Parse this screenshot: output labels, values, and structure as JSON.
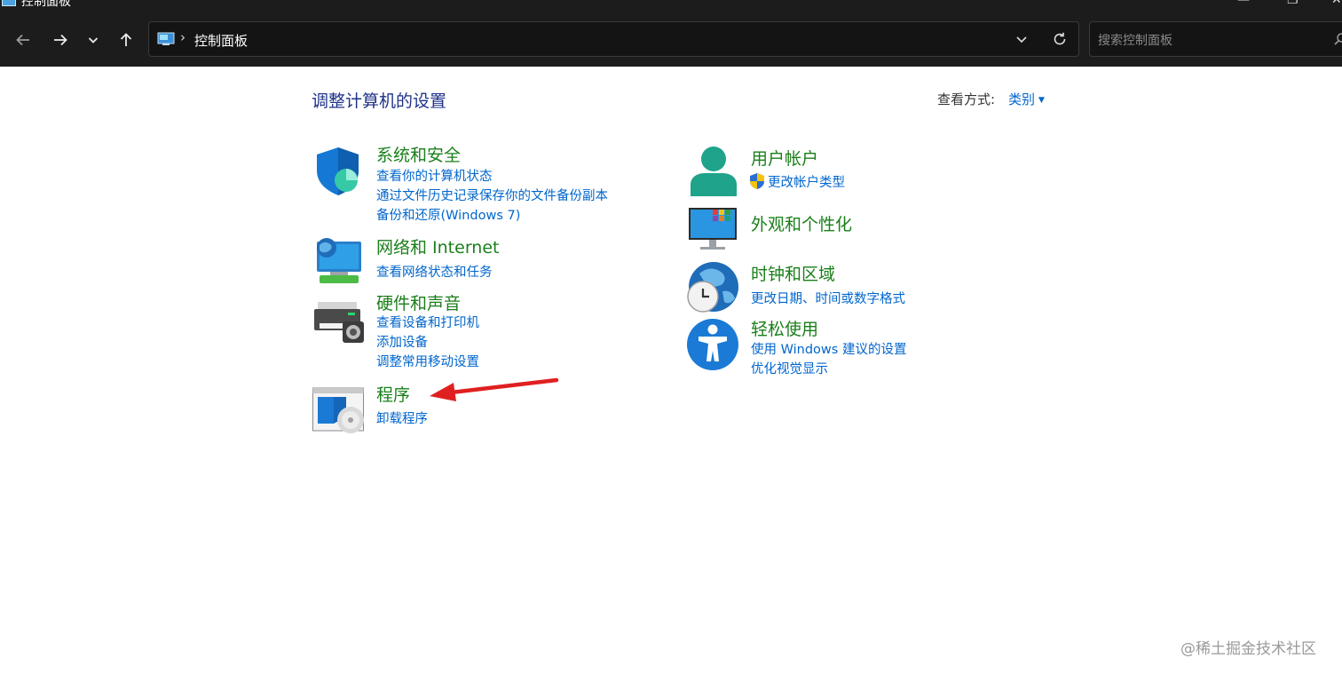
{
  "window": {
    "title": "控制面板"
  },
  "address_bar": {
    "crumb": "控制面板"
  },
  "search": {
    "placeholder": "搜索控制面板"
  },
  "content": {
    "title": "调整计算机的设置",
    "view_by_label": "查看方式:",
    "view_by_value": "类别"
  },
  "categories": [
    {
      "title": "系统和安全",
      "links": [
        "查看你的计算机状态",
        "通过文件历史记录保存你的文件备份副本",
        "备份和还原(Windows 7)"
      ],
      "icon": "shield-icon"
    },
    {
      "title": "网络和 Internet",
      "links": [
        "查看网络状态和任务"
      ],
      "icon": "network-icon"
    },
    {
      "title": "硬件和声音",
      "links": [
        "查看设备和打印机",
        "添加设备",
        "调整常用移动设置"
      ],
      "icon": "printer-icon"
    },
    {
      "title": "程序",
      "links": [
        "卸载程序"
      ],
      "icon": "programs-icon"
    },
    {
      "title": "用户帐户",
      "links": [
        "更改帐户类型"
      ],
      "icon": "user-icon"
    },
    {
      "title": "外观和个性化",
      "links": [],
      "icon": "monitor-icon"
    },
    {
      "title": "时钟和区域",
      "links": [
        "更改日期、时间或数字格式"
      ],
      "icon": "clock-globe-icon"
    },
    {
      "title": "轻松使用",
      "links": [
        "使用 Windows 建议的设置",
        "优化视觉显示"
      ],
      "icon": "accessibility-icon"
    }
  ],
  "watermark": "@稀土掘金技术社区",
  "colors": {
    "title_bar": "#1c1c1c",
    "category_title": "#1a7f1a",
    "link": "#0066cc",
    "page_title": "#1e3287",
    "annotation_arrow": "#e02020"
  }
}
